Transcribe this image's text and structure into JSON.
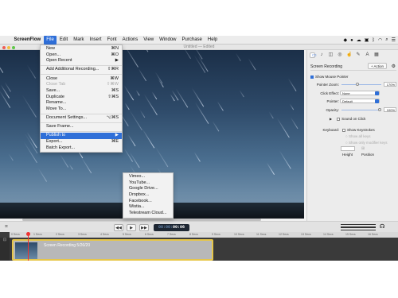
{
  "menubar": {
    "app": "ScreenFlow",
    "items": [
      "File",
      "Edit",
      "Mark",
      "Insert",
      "Font",
      "Actions",
      "View",
      "Window",
      "Purchase",
      "Help"
    ],
    "active": "File"
  },
  "window": {
    "title": "Untitled — Edited"
  },
  "file_menu": [
    {
      "label": "New",
      "shortcut": "⌘N"
    },
    {
      "label": "Open...",
      "shortcut": "⌘O"
    },
    {
      "label": "Open Recent",
      "shortcut": "▶"
    },
    {
      "sep": true
    },
    {
      "label": "Add Additional Recording...",
      "shortcut": "⇧⌘R"
    },
    {
      "sep": true
    },
    {
      "label": "Close",
      "shortcut": "⌘W"
    },
    {
      "label": "Close Tab",
      "shortcut": "⇧⌘W",
      "disabled": true
    },
    {
      "label": "Save...",
      "shortcut": "⌘S"
    },
    {
      "label": "Duplicate",
      "shortcut": "⇧⌘S"
    },
    {
      "label": "Rename..."
    },
    {
      "label": "Move To..."
    },
    {
      "sep": true
    },
    {
      "label": "Document Settings...",
      "shortcut": "⌥⌘S"
    },
    {
      "sep": true
    },
    {
      "label": "Save Frame..."
    },
    {
      "sep": true
    },
    {
      "label": "Publish to",
      "shortcut": "▶",
      "highlight": true
    },
    {
      "label": "Export...",
      "shortcut": "⌘E"
    },
    {
      "label": "Batch Export..."
    }
  ],
  "publish_menu": [
    "Vimeo...",
    "YouTube...",
    "Google Drive...",
    "Dropbox...",
    "Facebook...",
    "Wistia...",
    "Telestream Cloud..."
  ],
  "inspector": {
    "section_title": "Screen Recording",
    "action_button": "+ Action",
    "show_mouse_pointer": "Show Mouse Pointer",
    "pointer_zoom_label": "Pointer Zoom:",
    "pointer_zoom_value": "170%",
    "click_effect_label": "Click Effect:",
    "click_effect_value": "None",
    "pointer_label": "Pointer:",
    "pointer_value": "Default",
    "opacity_label": "Opacity:",
    "opacity_value": "100%",
    "sound_on_click": "Sound on Click",
    "keyboard_label": "Keyboard:",
    "show_keystrokes": "Show Keystrokes",
    "show_all_keys": "Show all keys",
    "show_only_modifier_keys": "Show only modifier keys",
    "height_label": "Height",
    "position_label": "Position"
  },
  "transport": {
    "rewind": "◀◀",
    "play": "▶",
    "forward": "▶▶",
    "timecode_prefix": "00:00:",
    "timecode_main": "00:06"
  },
  "timeline": {
    "ruler": [
      "0 Secs",
      "1 Secs",
      "2 Secs",
      "3 Secs",
      "4 Secs",
      "5 Secs",
      "6 Secs",
      "7 Secs",
      "8 Secs",
      "9 Secs",
      "10 Secs",
      "11 Secs",
      "12 Secs",
      "13 Secs",
      "14 Secs",
      "15 Secs",
      "16 Secs"
    ],
    "clip_title": "Screen Recording 5/26/20"
  }
}
